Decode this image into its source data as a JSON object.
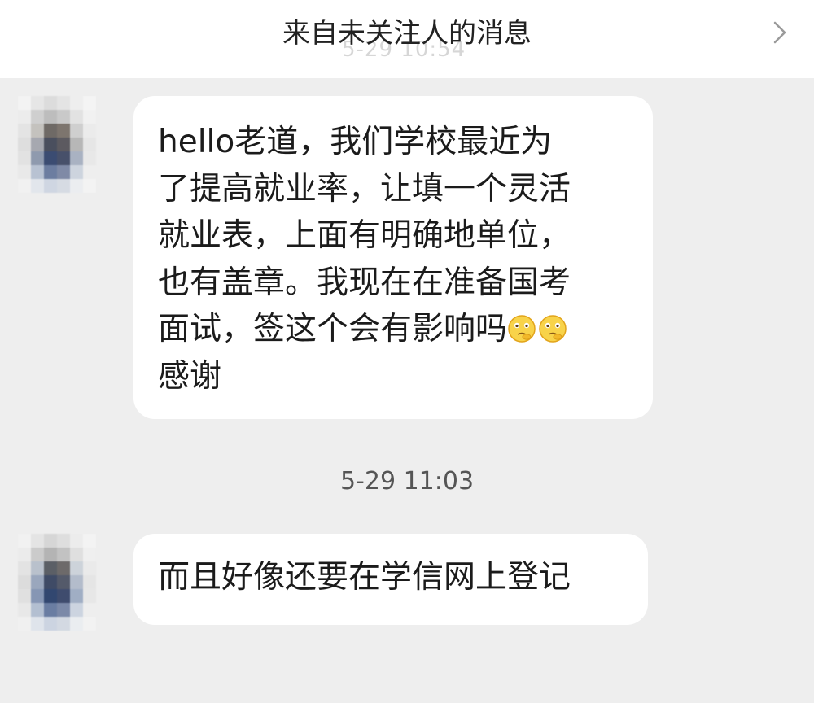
{
  "header": {
    "title": "来自未关注人的消息",
    "ghost_time": "5-29 10:54"
  },
  "messages": [
    {
      "text_before_emoji": "hello老道，我们学校最近为\n了提高就业率，让填一个灵活\n就业表，上面有明确地单位，\n也有盖章。我现在在准备国考\n面试，签这个会有影响吗",
      "emojis": [
        "thinking-face",
        "thinking-face"
      ],
      "text_after_emoji": "\n感谢"
    },
    {
      "text": "而且好像还要在学信网上登记"
    }
  ],
  "timestamp": "5-29 11:03",
  "colors": {
    "background": "#eeeeee",
    "bubble": "#ffffff",
    "header": "#ffffff"
  }
}
